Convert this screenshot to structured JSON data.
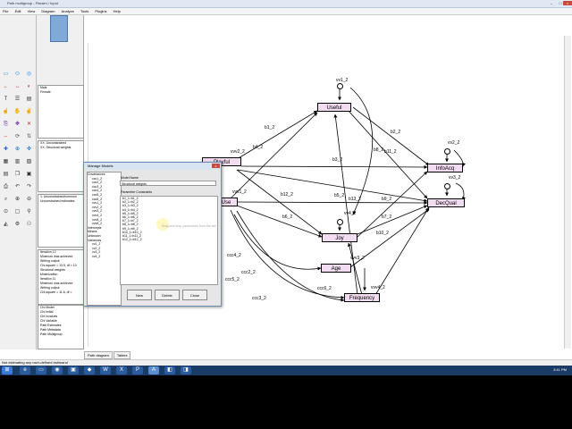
{
  "window": {
    "title": "Path multigroup - Fimalm / Input"
  },
  "menu": [
    "File",
    "Edit",
    "View",
    "Diagram",
    "Analyze",
    "Tools",
    "Plugins",
    "Help"
  ],
  "panels": {
    "groups": [
      "Male",
      "Female"
    ],
    "models": [
      "XX: Unconstrained",
      "XX: Structural weights"
    ],
    "models2": [
      "1: Unconstrained/common",
      "Unconstrained estimates"
    ],
    "log": [
      "Iteration 12",
      "Minimum was achieved",
      "Writing output",
      "Chi-square = 13.5, df = 10",
      "Structural weights",
      "Minimization",
      "Iteration 11",
      "Minimum was achieved",
      "Writing output",
      "Chi-square = 11.6, df ="
    ],
    "files": [
      "Chi Model",
      "Chi Initial",
      "Chi Invalues",
      "Chi Variable",
      "Path Estimates",
      "Path Metadata",
      "Path Multigroup"
    ]
  },
  "diagram": {
    "nodes": {
      "useful": "Useful",
      "playful": "Playful",
      "infoacq": "InfoAcq",
      "decqual": "DecQual",
      "use": "Use",
      "joy": "Joy",
      "age": "Age",
      "frequency": "Frequency"
    },
    "errors": [
      "vv1_2",
      "vv2_2",
      "vv3_2",
      "vv4_2",
      "vv5_2",
      "vv6_2"
    ],
    "paths": [
      "b1_2",
      "b4_2",
      "vvv2_2",
      "vvv1_2",
      "b3_2",
      "b2_2",
      "b12_2",
      "b5_2",
      "b6_2",
      "b9_2",
      "b7_2",
      "b10_2",
      "b13_2",
      "b8_2",
      "b11_2",
      "ccc4_2",
      "ccc2_2",
      "ccc5_2",
      "ccc6_2",
      "ccc3_2",
      "vvv4_2",
      "vvv3_2"
    ]
  },
  "dialog": {
    "title": "Manage Models",
    "close_x": "x",
    "tree": [
      "Covariances",
      "ccc1_2",
      "ccc2_2",
      "ccc3_2",
      "ccc4_2",
      "ccc5_2",
      "ccc6_2",
      "vvv1_2",
      "vvv2_2",
      "vvv3_2",
      "vvv4_2",
      "vvv5_2",
      "vvv6_2",
      "Intercepts",
      "Means",
      "Unknown",
      "Variances",
      "vv1_2",
      "vv2_2",
      "vv3_2",
      "vv4_2"
    ],
    "model_name_label": "Model Name",
    "model_name_value": "Structural weights",
    "constraints_label": "Parameter Constraints",
    "constraints": [
      "b1_1=b1_2",
      "b2_1=b2_2",
      "b3_1=b3_2",
      "b4_1=b4_2",
      "b5_1=b5_2",
      "b6_1=b6_2",
      "b7_1=b7_2",
      "b8_1=b8_2",
      "b9_1=b9_2",
      "b10_1=b10_2",
      "b11_1=b11_2",
      "b12_1=b12_2"
    ],
    "hint": "Drag and drop parameters from the left",
    "buttons": {
      "new": "New",
      "delete": "Delete",
      "close": "Close"
    }
  },
  "tabs": [
    "Path diagram",
    "Tables"
  ],
  "status": "Not estimating any user-defined estimand",
  "clock": "3:41 PM"
}
